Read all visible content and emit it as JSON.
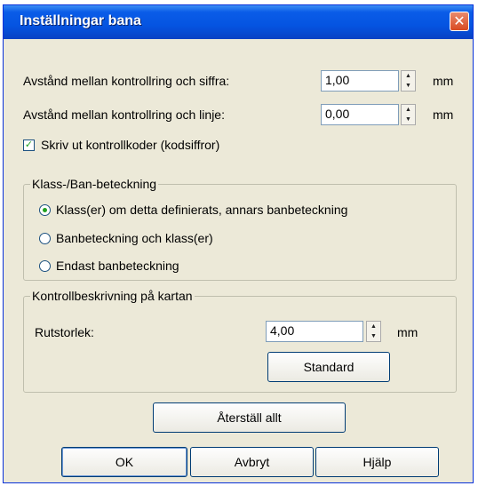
{
  "dialog": {
    "title": "Inställningar bana",
    "close_glyph": "✕"
  },
  "settings": {
    "dist_number_label": "Avstånd mellan kontrollring och siffra:",
    "dist_number_value": "1,00",
    "dist_line_label": "Avstånd mellan kontrollring och linje:",
    "dist_line_value": "0,00",
    "unit": "mm",
    "print_codes_label": "Skriv ut kontrollkoder (kodsiffror)",
    "print_codes_checked": true
  },
  "class_group": {
    "legend": "Klass-/Ban-beteckning",
    "options": [
      {
        "label": "Klass(er) om detta definierats, annars banbeteckning",
        "selected": true
      },
      {
        "label": "Banbeteckning och klass(er)",
        "selected": false
      },
      {
        "label": "Endast banbeteckning",
        "selected": false
      }
    ]
  },
  "desc_group": {
    "legend": "Kontrollbeskrivning på kartan",
    "size_label": "Rutstorlek:",
    "size_value": "4,00",
    "unit": "mm",
    "standard_button": "Standard"
  },
  "buttons": {
    "reset_all": "Återställ allt",
    "ok": "OK",
    "cancel": "Avbryt",
    "help": "Hjälp"
  },
  "icons": {
    "close": "close-icon",
    "spin_up": "arrow-up-icon",
    "spin_down": "arrow-down-icon",
    "check": "checkmark-icon"
  },
  "colors": {
    "titlebar": "#0554e1",
    "face": "#ece9d8",
    "close": "#d94a21"
  }
}
